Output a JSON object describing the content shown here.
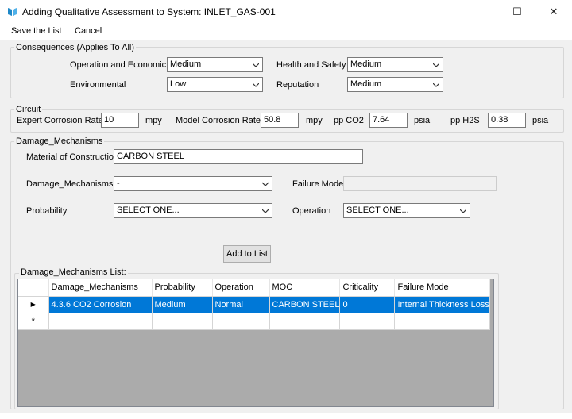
{
  "window": {
    "title": "Adding Qualitative Assessment to System: INLET_GAS-001",
    "minimize": "—",
    "maximize": "☐",
    "close": "✕"
  },
  "menu": {
    "save": "Save the List",
    "cancel": "Cancel"
  },
  "consequences": {
    "legend": "Consequences (Applies To All)",
    "operation_economic_label": "Operation and Economic",
    "operation_economic_value": "Medium",
    "health_safety_label": "Health and Safety",
    "health_safety_value": "Medium",
    "environmental_label": "Environmental",
    "environmental_value": "Low",
    "reputation_label": "Reputation",
    "reputation_value": "Medium"
  },
  "circuit": {
    "legend": "Circuit",
    "expert_label": "Expert Corrosion Rate",
    "expert_value": "10",
    "expert_unit": "mpy",
    "model_label": "Model Corrosion Rate",
    "model_value": "50.8",
    "model_unit": "mpy",
    "co2_label": "pp CO2",
    "co2_value": "7.64",
    "co2_unit": "psia",
    "h2s_label": "pp H2S",
    "h2s_value": "0.38",
    "h2s_unit": "psia"
  },
  "damage": {
    "legend": "Damage_Mechanisms",
    "material_label": "Material of Construction",
    "material_value": "CARBON STEEL",
    "mechanism_label": "Damage_Mechanisms",
    "mechanism_value": "-",
    "failure_mode_label": "Failure Mode",
    "failure_mode_value": "",
    "probability_label": "Probability",
    "probability_value": "SELECT ONE...",
    "operation_label": "Operation",
    "operation_value": "SELECT ONE...",
    "add_button": "Add to List",
    "list_legend": "Damage_Mechanisms List:"
  },
  "grid": {
    "columns": [
      "Damage_Mechanisms",
      "Probability",
      "Operation",
      "MOC",
      "Criticality",
      "Failure Mode"
    ],
    "rows": [
      [
        "4.3.6 CO2 Corrosion",
        "Medium",
        "Normal",
        "CARBON STEEL",
        "0",
        "Internal Thickness Loss"
      ]
    ],
    "current_row_marker": "▶",
    "new_row_marker": "*"
  },
  "colors": {
    "selection": "#0078d7",
    "form_background": "#f0f0f0"
  }
}
